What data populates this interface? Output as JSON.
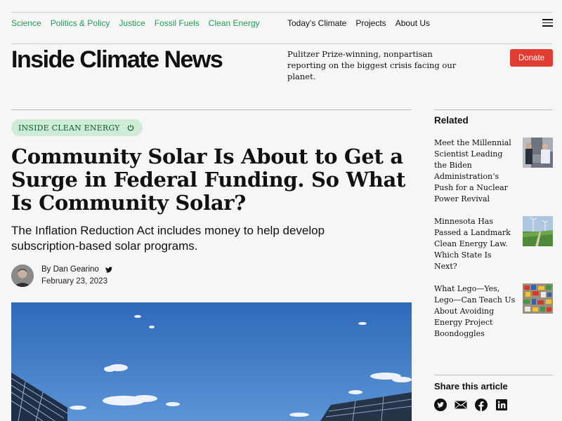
{
  "nav": {
    "categories": [
      "Science",
      "Politics & Policy",
      "Justice",
      "Fossil Fuels",
      "Clean Energy"
    ],
    "sections": [
      "Today's Climate",
      "Projects",
      "About Us"
    ],
    "menu_icon": "hamburger-menu-icon"
  },
  "site": {
    "name": "Inside Climate News",
    "tagline": "Pulitzer Prize-winning, nonpartisan reporting on the biggest crisis facing our planet.",
    "donate_label": "Donate"
  },
  "article": {
    "series_label": "INSIDE CLEAN ENERGY",
    "series_icon": "power-icon",
    "headline": "Community Solar Is About to Get a Surge in Federal Funding. So What Is Community Solar?",
    "dek": "The Inflation Reduction Act includes money to help develop subscription-based solar programs.",
    "author": "By Dan Gearino",
    "author_icon": "twitter-icon",
    "date": "February 23, 2023"
  },
  "related": {
    "title": "Related",
    "items": [
      {
        "text": "Meet the Millennial Scientist Leading the Biden Administration’s Push for a Nuclear Power Revival"
      },
      {
        "text": "Minnesota Has Passed a Landmark Clean Energy Law. Which State Is Next?"
      },
      {
        "text": "What Lego—Yes, Lego—Can Teach Us About Avoiding Energy Project Boondoggles"
      }
    ]
  },
  "share": {
    "title": "Share this article",
    "icons": [
      "twitter-icon",
      "email-icon",
      "facebook-icon",
      "linkedin-icon"
    ]
  },
  "colors": {
    "accent_green": "#1f9a55",
    "donate_red": "#e03c31",
    "pill_bg": "#cdebd6",
    "background": "#f6f6f6"
  }
}
